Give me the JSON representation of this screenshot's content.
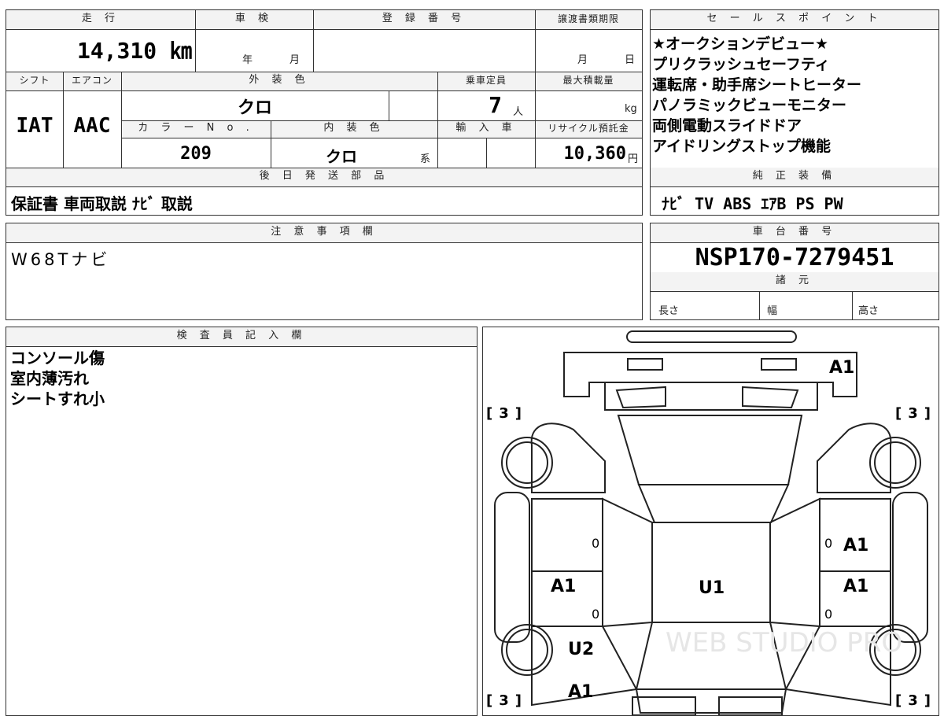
{
  "headers": {
    "mileage": "走 行",
    "inspection": "車 検",
    "registration_no": "登 録 番 号",
    "transfer_deadline": "譲渡書類期限",
    "sales_points": "セ ー ル ス ポ イ ン ト",
    "shift": "シフト",
    "aircon": "エアコン",
    "exterior_color": "外 装 色",
    "capacity": "乗車定員",
    "max_load": "最大積載量",
    "color_no": "カ ラ ー N o .",
    "interior_color": "内 装 色",
    "import": "輸 入 車",
    "recycle_fee": "リサイクル預託金",
    "parts_later": "後 日 発 送 部 品",
    "equipment": "純 正 装 備",
    "notes": "注 意 事 項 欄",
    "chassis_no": "車 台 番 号",
    "specs": "諸 元",
    "inspector": "検 査 員 記 入 欄"
  },
  "values": {
    "mileage": "14,310 ㎞",
    "inspection_year": "年",
    "inspection_month": "月",
    "transfer_month": "月",
    "transfer_day": "日",
    "shift": "IAT",
    "aircon": "AAC",
    "exterior_color": "クロ",
    "capacity": "7",
    "capacity_unit": "人",
    "max_load_unit": "kg",
    "color_no": "209",
    "interior_color": "クロ",
    "interior_suffix": "系",
    "recycle_fee": "10,360",
    "recycle_unit": "円",
    "parts_later": "保証書 車両取説 ﾅﾋﾞ 取説",
    "equipment": "ﾅﾋﾞ TV ABS ｴｱB PS PW",
    "notes": "W68Tナビ",
    "chassis_no": "NSP170-7279451",
    "length": "長さ",
    "width": "幅",
    "height": "高さ"
  },
  "sales_points": [
    "★オークションデビュー★",
    "プリクラッシュセーフティ",
    "運転席・助手席シートヒーター",
    "パノラミックビューモニター",
    "両側電動スライドドア",
    "アイドリングストップ機能"
  ],
  "inspector_notes": [
    "コンソール傷",
    "室内薄汚れ",
    "シートすれ小"
  ],
  "diagram": {
    "marks": {
      "rear_right": "A1",
      "right_rear_door": "A1",
      "left_slide_door": "A1",
      "right_slide_door": "A1",
      "roof": "U1",
      "left_front_fender": "U2",
      "front_left": "A1"
    },
    "tire_tl": "3",
    "tire_tr": "3",
    "tire_bl": "3",
    "tire_br": "3",
    "zero_1": "0",
    "zero_2": "0",
    "zero_3": "0",
    "zero_4": "0",
    "watermark": "WEB STUDIO PRO"
  }
}
